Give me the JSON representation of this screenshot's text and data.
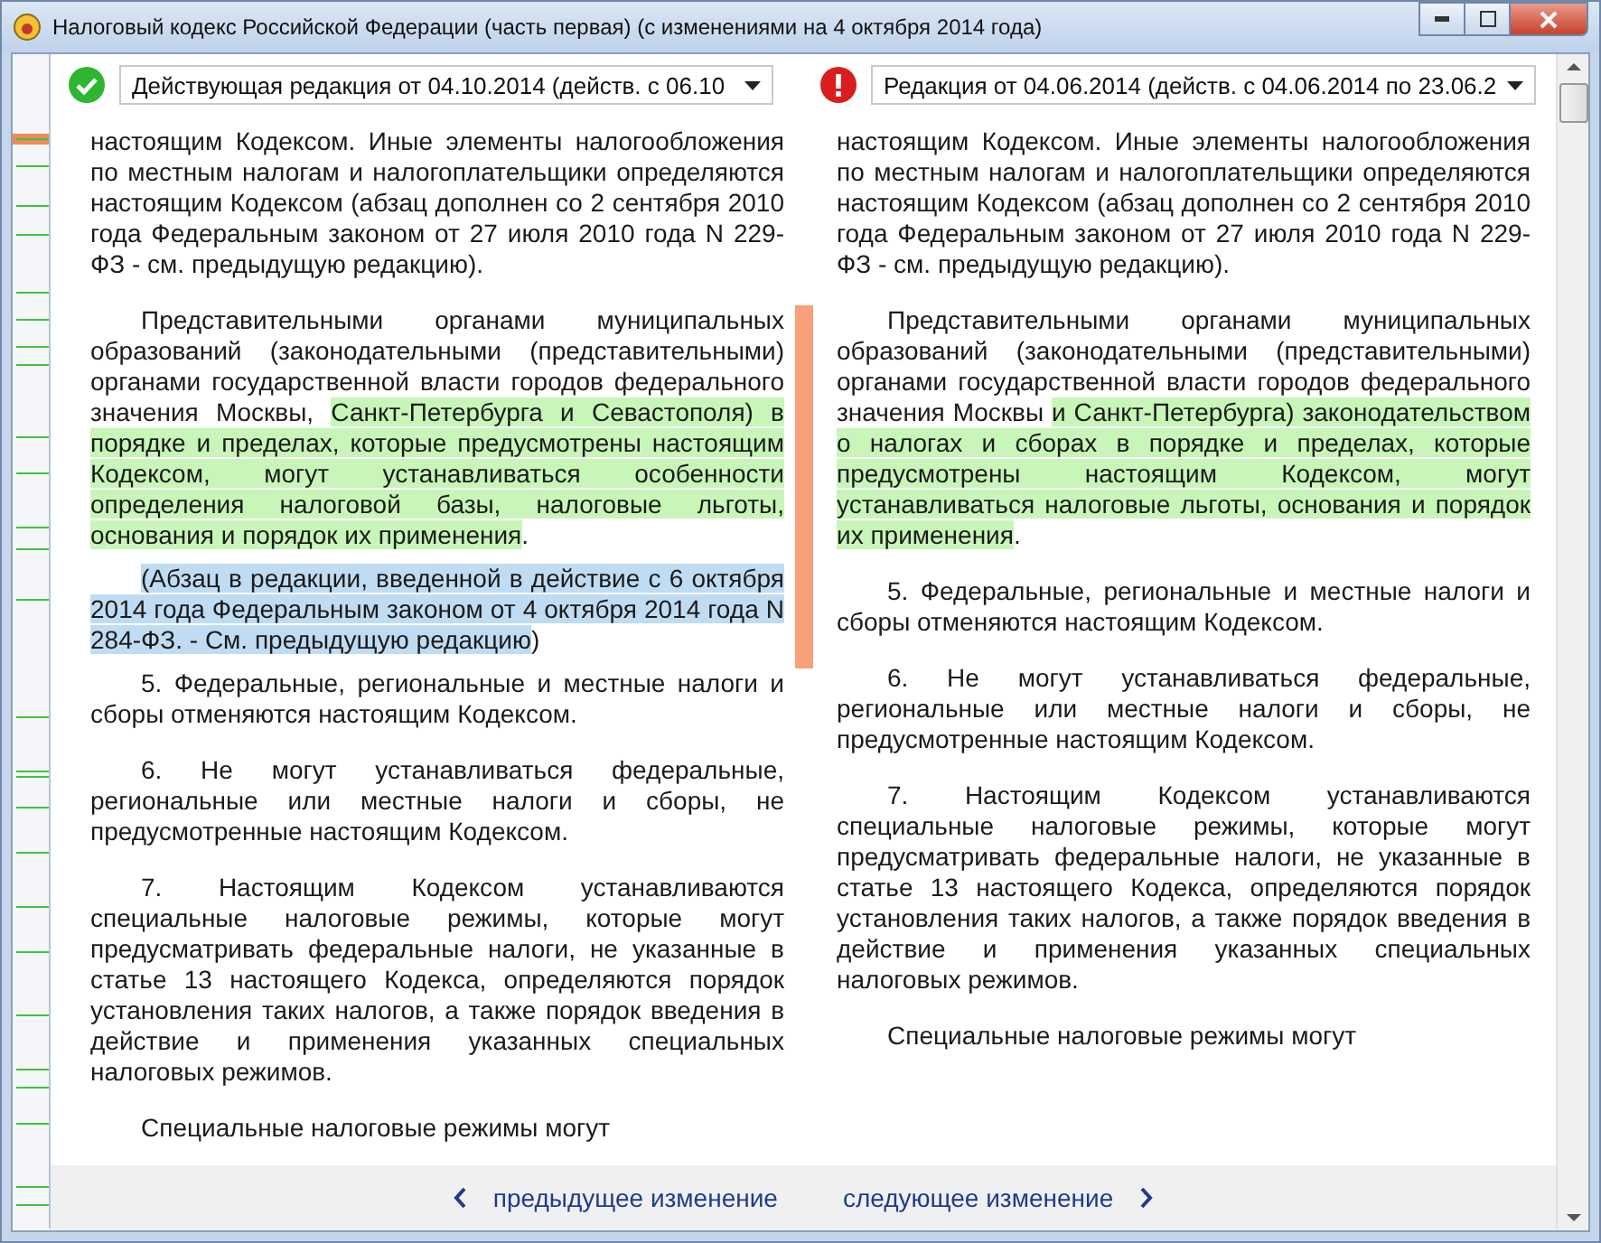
{
  "window": {
    "title": "Налоговый кодекс Российской Федерации (часть первая) (с изменениями на 4 октября 2014 года)"
  },
  "versions": [
    {
      "label": "Действующая редакция от 04.10.2014 (действ. с 06.10",
      "kind": "current"
    },
    {
      "label": "Редакция от 04.06.2014 (действ. с 04.06.2014 по 23.06.2",
      "kind": "outdated"
    }
  ],
  "columns": [
    {
      "paragraphs": [
        {
          "marked": false,
          "indent": false,
          "segments": [
            {
              "text": "настоящим Кодексом. Иные элементы налогообложения по местным налогам и налогоплательщики определяются настоящим Кодексом (абзац дополнен со 2 сентября 2010 года Федеральным законом от 27 июля 2010 года N 229-ФЗ - см. предыдущую редакцию).",
              "kind": "plain"
            }
          ]
        },
        {
          "marked": true,
          "indent": true,
          "segments": [
            {
              "text": "Представительными органами муниципальных образований (законодательными (представительными) органами государственной власти городов федерального значения Москвы, ",
              "kind": "plain"
            },
            {
              "text": "Санкт-Петербурга и Севастополя) в порядке и пределах, которые предусмотрены настоящим Кодексом, могут устанавливаться особенности определения налоговой базы, налоговые льготы, основания и порядок их применения",
              "kind": "added"
            },
            {
              "text": ".",
              "kind": "plain"
            }
          ]
        },
        {
          "marked": true,
          "indent": true,
          "segments": [
            {
              "text": "(Абзац в редакции, введенной в действие с 6 октября 2014 года Федеральным законом от 4 октября 2014 года N 284-ФЗ. - См. предыдущую редакцию",
              "kind": "note"
            },
            {
              "text": ")",
              "kind": "plain"
            }
          ]
        },
        {
          "marked": false,
          "indent": true,
          "segments": [
            {
              "text": "5. Федеральные, региональные и местные налоги и сборы отменяются настоящим Кодексом.",
              "kind": "plain"
            }
          ]
        },
        {
          "marked": false,
          "indent": true,
          "segments": [
            {
              "text": "6. Не могут устанавливаться федеральные, региональные или местные налоги и сборы, не предусмотренные настоящим Кодексом.",
              "kind": "plain"
            }
          ]
        },
        {
          "marked": false,
          "indent": true,
          "segments": [
            {
              "text": "7. Настоящим Кодексом устанавливаются специальные налоговые режимы, которые могут предусматривать федеральные налоги, не указанные в статье 13 настоящего Кодекса, определяются порядок установления таких налогов, а также порядок введения в действие и применения указанных специальных налоговых режимов.",
              "kind": "plain"
            }
          ]
        },
        {
          "marked": false,
          "indent": true,
          "segments": [
            {
              "text": "Специальные налоговые режимы могут",
              "kind": "plain"
            }
          ]
        }
      ]
    },
    {
      "paragraphs": [
        {
          "marked": false,
          "indent": false,
          "segments": [
            {
              "text": "настоящим Кодексом. Иные элементы налогообложения по местным налогам и налогоплательщики определяются настоящим Кодексом (абзац дополнен со 2 сентября 2010 года Федеральным законом от 27 июля 2010 года N 229-ФЗ - см. предыдущую редакцию).",
              "kind": "plain"
            }
          ]
        },
        {
          "marked": false,
          "indent": true,
          "segments": [
            {
              "text": "Представительными органами муниципальных образований (законодательными (представительными) органами государственной власти городов федерального значения Москвы ",
              "kind": "plain"
            },
            {
              "text": "и Санкт-Петербурга) законодательством о налогах и сборах в порядке и пределах, которые предусмотрены настоящим Кодексом, могут устанавливаться налоговые льготы, основания и порядок их применения",
              "kind": "added"
            },
            {
              "text": ".",
              "kind": "plain"
            }
          ]
        },
        {
          "marked": false,
          "indent": true,
          "segments": [
            {
              "text": "5. Федеральные, региональные и местные налоги и сборы отменяются настоящим Кодексом.",
              "kind": "plain"
            }
          ]
        },
        {
          "marked": false,
          "indent": true,
          "segments": [
            {
              "text": "6. Не могут устанавливаться федеральные, региональные или местные налоги и сборы, не предусмотренные настоящим Кодексом.",
              "kind": "plain"
            }
          ]
        },
        {
          "marked": false,
          "indent": true,
          "segments": [
            {
              "text": "7. Настоящим Кодексом устанавливаются специальные налоговые режимы, которые могут предусматривать федеральные налоги, не указанные в статье 13 настоящего Кодекса, определяются порядок установления таких налогов, а также порядок введения в действие и применения указанных специальных налоговых режимов.",
              "kind": "plain"
            }
          ]
        },
        {
          "marked": false,
          "indent": true,
          "segments": [
            {
              "text": "Специальные налоговые режимы могут",
              "kind": "plain"
            }
          ]
        }
      ]
    }
  ],
  "navigation": {
    "previous": "предыдущее изменение",
    "next": "следующее изменение"
  }
}
